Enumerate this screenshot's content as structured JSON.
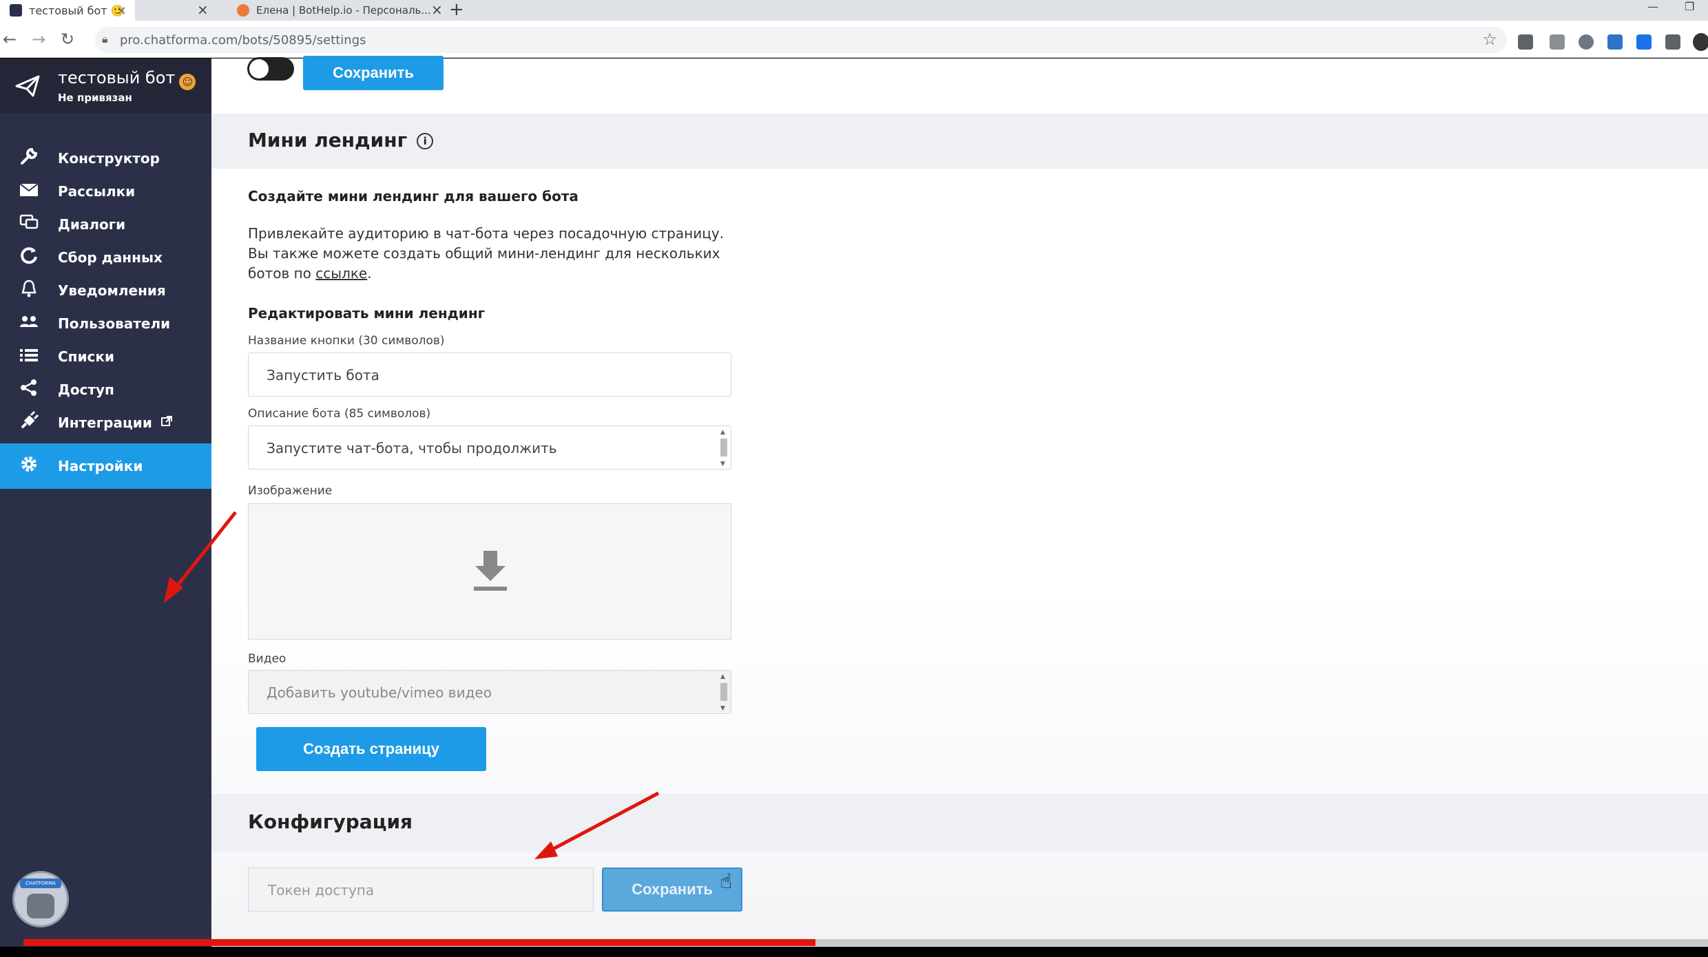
{
  "browser": {
    "tabs": [
      {
        "title": "тестовый бот 🙂",
        "close": "×"
      },
      {
        "title": "Елена | BotHelp.io - Персональ...",
        "close": "×"
      }
    ],
    "new_tab": "+",
    "url": "pro.chatforma.com/bots/50895/settings"
  },
  "sidebar": {
    "bot_name": "тестовый бот",
    "bot_status": "Не привязан",
    "items": [
      {
        "label": "Конструктор",
        "icon": "wrench-icon"
      },
      {
        "label": "Рассылки",
        "icon": "envelope-icon"
      },
      {
        "label": "Диалоги",
        "icon": "chat-icon"
      },
      {
        "label": "Сбор данных",
        "icon": "refresh-icon"
      },
      {
        "label": "Уведомления",
        "icon": "bell-icon"
      },
      {
        "label": "Пользователи",
        "icon": "users-icon"
      },
      {
        "label": "Списки",
        "icon": "list-icon"
      },
      {
        "label": "Доступ",
        "icon": "share-icon"
      },
      {
        "label": "Интеграции",
        "icon": "plug-icon"
      },
      {
        "label": "Настройки",
        "icon": "gear-icon"
      }
    ],
    "active_item": "Настройки",
    "avatar_label": "CHATFORMA"
  },
  "main": {
    "top_save": "Сохранить",
    "landing": {
      "title": "Мини лендинг",
      "info": "i",
      "intro_heading": "Создайте мини лендинг для вашего бота",
      "intro_line1": "Привлекайте аудиторию в чат-бота через посадочную страницу.",
      "intro_line2": "Вы также можете создать общий мини-лендинг для нескольких",
      "intro_line3_before": "ботов по ",
      "intro_link": "ссылке",
      "intro_line3_after": ".",
      "edit_heading": "Редактировать мини лендинг",
      "button_name_label": "Название кнопки (30 символов)",
      "button_name_value": "Запустить бота",
      "description_label": "Описание бота (85 символов)",
      "description_value": "Запустите чат-бота, чтобы продолжить",
      "image_label": "Изображение",
      "video_label": "Видео",
      "video_placeholder": "Добавить youtube/vimeo видео",
      "create_button": "Создать страницу"
    },
    "config": {
      "title": "Конфигурация",
      "token_placeholder": "Токен доступа",
      "save_button": "Сохранить"
    }
  },
  "video_progress": 0.47,
  "colors": {
    "accent": "#1e9be6",
    "sidebar": "#2b3048",
    "annotation": "#e0160e"
  }
}
